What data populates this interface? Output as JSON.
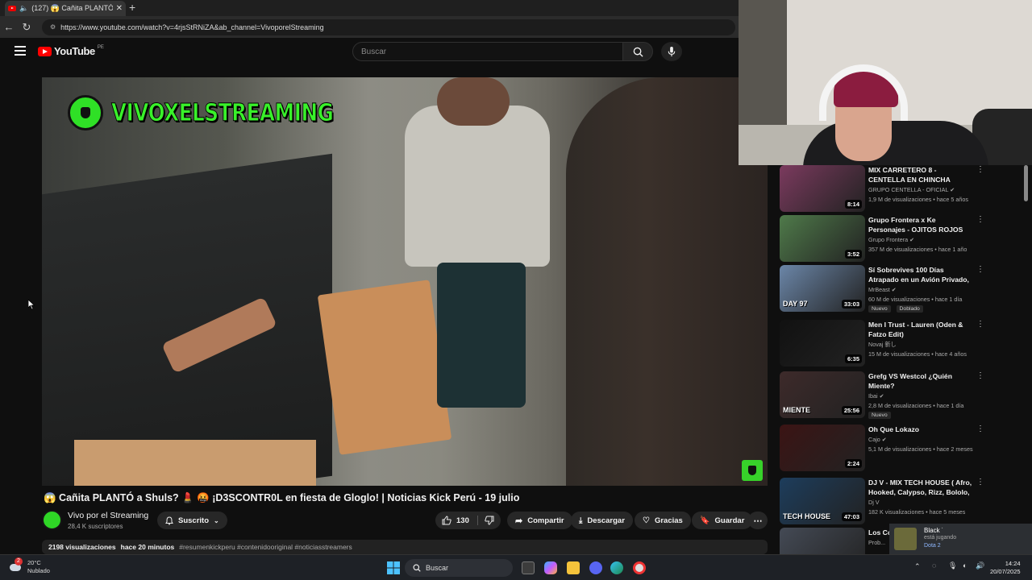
{
  "browser": {
    "tab_title": "(127) 😱 Cañita PLANTÓ a S",
    "url": "https://www.youtube.com/watch?v=4rjsStRNiZA&ab_channel=VivoporelStreaming"
  },
  "header": {
    "logo_text": "YouTube",
    "country_code": "PE",
    "search_placeholder": "Buscar"
  },
  "video": {
    "watermark_text": "VIVOXELSTREAMING",
    "title": "😱 Cañita PLANTÓ a Shuls? 💄 🤬 ¡D3SCONTR0L en fiesta de Gloglo! | Noticias Kick Perú - 19 julio",
    "channel_name": "Vivo por el Streaming",
    "subscribers": "28,4 K suscriptores",
    "subscribed_label": "Suscrito",
    "like_count": "130",
    "share_label": "Compartir",
    "download_label": "Descargar",
    "thanks_label": "Gracias",
    "save_label": "Guardar",
    "views": "2198 visualizaciones",
    "age": "hace 20 minutos",
    "hashtags": "#resumenkickperu #contenidooriginal #noticiasstreamers"
  },
  "recommendations": [
    {
      "title": "MIX CARRETERO 8 - CENTELLA EN CHINCHA",
      "channel": "GRUPO CENTELLA - OFICIAL",
      "verified": true,
      "meta": "1,9 M de visualizaciones • hace 5 años",
      "duration": "8:14",
      "thumb_color": "#7b3a5e"
    },
    {
      "title": "Grupo Frontera x Ke Personajes - OJITOS ROJOS (Video Oficial)",
      "channel": "Grupo Frontera",
      "verified": true,
      "meta": "357 M de visualizaciones • hace 1 año",
      "duration": "3:52",
      "thumb_color": "#4f7a4a"
    },
    {
      "title": "Sí Sobrevives 100 Días Atrapado en un Avión Privado, ...",
      "channel": "MrBeast",
      "verified": true,
      "meta": "60 M de visualizaciones • hace 1 día",
      "duration": "33:03",
      "thumb_color": "#6b86a8",
      "badges": [
        "Nuevo",
        "Doblado"
      ],
      "overlay_text": "DAY 97"
    },
    {
      "title": "Men I Trust - Lauren (Oden & Fatzo Edit)",
      "channel": "Novaj 新し",
      "verified": false,
      "meta": "15 M de visualizaciones • hace 4 años",
      "duration": "6:35",
      "thumb_color": "#111111"
    },
    {
      "title": "Grefg VS Westcol ¿Quién Miente?",
      "channel": "Ibai",
      "verified": true,
      "meta": "2,8 M de visualizaciones • hace 1 día",
      "duration": "25:56",
      "thumb_color": "#3d2a2a",
      "badges": [
        "Nuevo"
      ],
      "overlay_text": "MIENTE"
    },
    {
      "title": "Oh Que Lokazo",
      "channel": "Cajo",
      "verified": true,
      "meta": "5,1 M de visualizaciones • hace 2 meses",
      "duration": "2:24",
      "thumb_color": "#3b1414"
    },
    {
      "title": "DJ V - MIX TECH HOUSE ( Afro, Hooked, Calypso, Rizz, Bololo, ...",
      "channel": "Dj V",
      "verified": false,
      "meta": "182 K visualizaciones • hace 5 meses",
      "duration": "47:03",
      "thumb_color": "#1d3d5c",
      "overlay_text": "TECH HOUSE"
    },
    {
      "title": "Los Co... de Nue...",
      "channel": "Prob...",
      "verified": false,
      "meta": "",
      "duration": "",
      "thumb_color": "#444a55"
    }
  ],
  "discord_popup": {
    "user": "Black ˙",
    "status": "está jugando",
    "game": "Dota 2"
  },
  "taskbar": {
    "temperature": "20°C",
    "weather": "Nublado",
    "search_label": "Buscar",
    "time": "14:24",
    "date": "20/07/2025",
    "notification_count": "2"
  }
}
